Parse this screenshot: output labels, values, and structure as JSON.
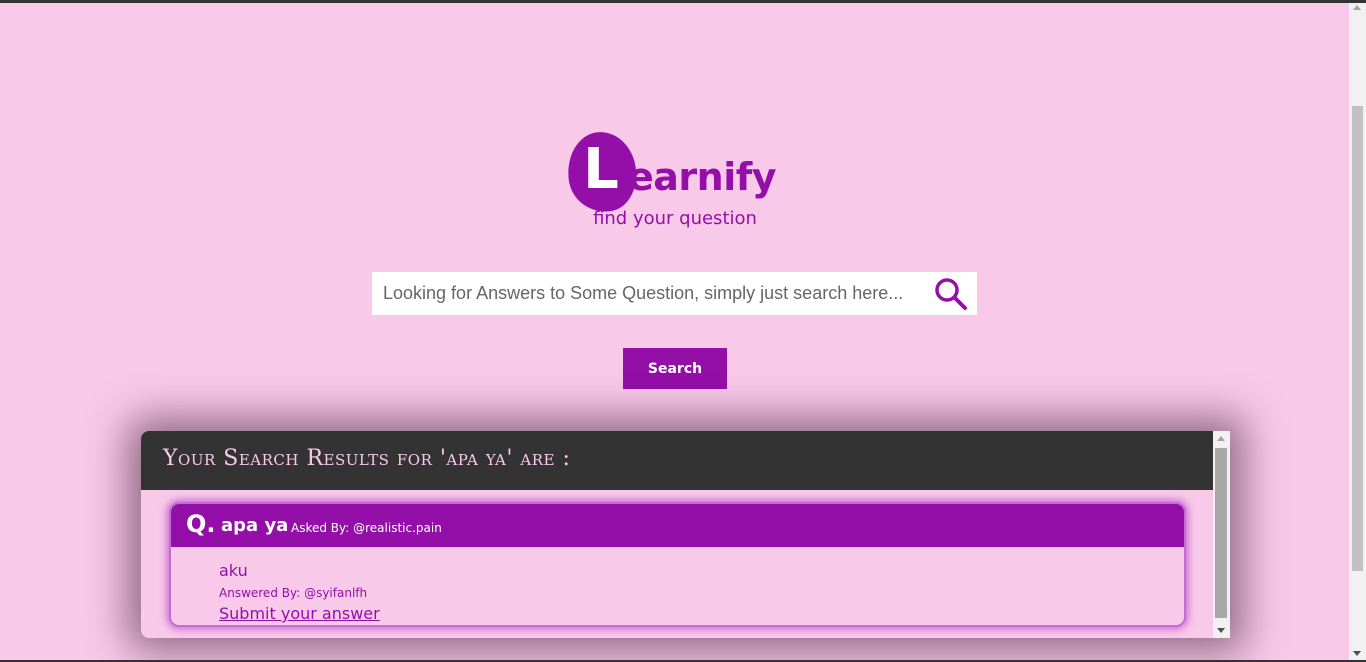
{
  "colors": {
    "background": "#f9c9ea",
    "brand": "#940fa8",
    "header_dark": "#333333",
    "white": "#ffffff"
  },
  "logo": {
    "initial": "L",
    "rest": "earnify"
  },
  "tagline": "find your question",
  "search": {
    "placeholder": "Looking for Answers to Some Question, simply just search here...",
    "value": "",
    "icon": "search-icon",
    "button_label": "Search"
  },
  "results": {
    "title": "Your Search Results for 'apa ya' are :",
    "questions": [
      {
        "mark": "Q.",
        "text": "apa ya",
        "asked_by": "Asked By: @realistic.pain",
        "answer": "aku",
        "answered_by": "Answered By: @syifanlfh",
        "submit_label": "Submit your answer"
      }
    ]
  }
}
